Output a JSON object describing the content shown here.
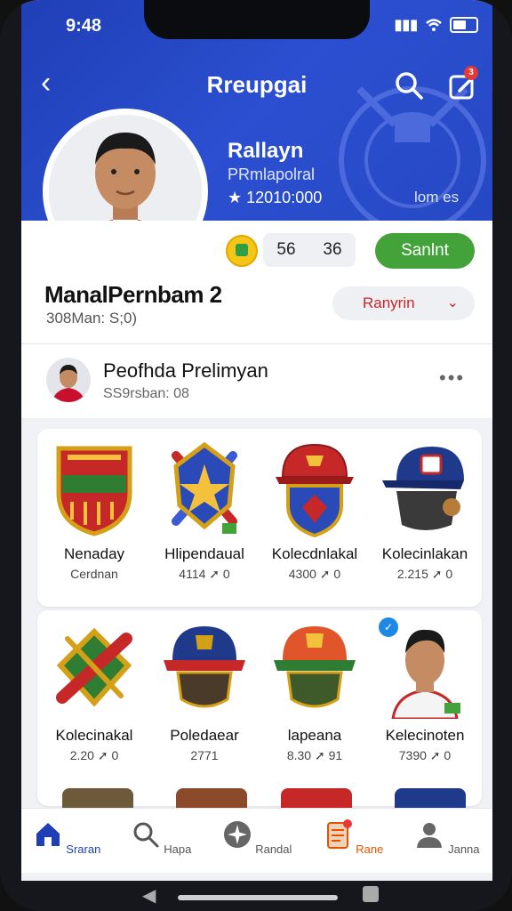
{
  "status": {
    "time": "9:48"
  },
  "header": {
    "title": "Rreupgai"
  },
  "profile": {
    "name": "Rallayn",
    "role": "PRmlapolral",
    "score": "★ 12010:000",
    "right_text": "lom es"
  },
  "stats": {
    "left": "56",
    "right": "36",
    "save_label": "Sanlnt"
  },
  "collection": {
    "title": "ManalPernbam 2",
    "subtitle": "308Man: S;0)",
    "dropdown": "Ranyrin"
  },
  "owner": {
    "name": "Peofhda Prelimyan",
    "subtitle": "SS9rsban: 08",
    "more": "•••"
  },
  "items_row1": [
    {
      "name": "Nenaday",
      "meta": "Cerdnan"
    },
    {
      "name": "Hlipendaual",
      "meta": "4114 ➚ 0"
    },
    {
      "name": "Kolecdnlakal",
      "meta": "4300 ➚ 0"
    },
    {
      "name": "Kolecinlakan",
      "meta": "2.215 ➚ 0"
    }
  ],
  "items_row2": [
    {
      "name": "Kolecinakal",
      "meta": "2.20 ➚ 0"
    },
    {
      "name": "Poledaear",
      "meta": "2771"
    },
    {
      "name": "lapeana",
      "meta": "8.30 ➚ 91"
    },
    {
      "name": "Kelecinoten",
      "meta": "7390 ➚ 0"
    }
  ],
  "nav": [
    {
      "label": "Sraran",
      "icon": "home-icon"
    },
    {
      "label": "Hapa",
      "icon": "search-icon"
    },
    {
      "label": "Randal",
      "icon": "compass-icon"
    },
    {
      "label": "Rane",
      "icon": "list-icon"
    },
    {
      "label": "Janna",
      "icon": "person-icon"
    }
  ],
  "colors": {
    "primary": "#2748c8",
    "accent_green": "#43a33a",
    "accent_red": "#c62828",
    "active_nav": "#1f3fb6",
    "active_tab": "#e65100"
  }
}
